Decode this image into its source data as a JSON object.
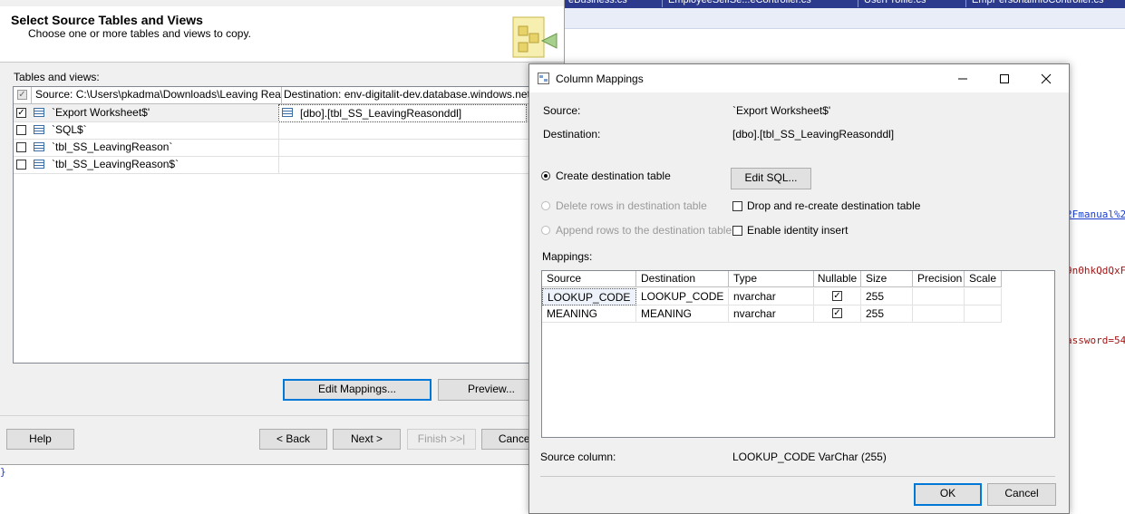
{
  "ide": {
    "tabs": [
      "eBusiness.cs",
      "EmployeeSelfSe...eController.cs",
      "UserProfile.cs",
      "EmpPersonalInfoController.cs"
    ],
    "code_fragments": [
      "2Fmanual%2",
      "9n0hkQdQxF",
      "assword=54"
    ]
  },
  "wizard": {
    "title": "Select Source Tables and Views",
    "subtitle": "Choose one or more tables and views to copy.",
    "list_label": "Tables and views:",
    "col_source": "Source: C:\\Users\\pkadma\\Downloads\\Leaving Rea...",
    "col_destination": "Destination: env-digitalit-dev.database.windows.net",
    "rows": [
      {
        "source": "`Export Worksheet$'",
        "destination": "[dbo].[tbl_SS_LeavingReasonddl]",
        "checked": true
      },
      {
        "source": "`SQL$`",
        "destination": "",
        "checked": false
      },
      {
        "source": "`tbl_SS_LeavingReason`",
        "destination": "",
        "checked": false
      },
      {
        "source": "`tbl_SS_LeavingReason$`",
        "destination": "",
        "checked": false
      }
    ],
    "edit_mappings": "Edit Mappings...",
    "preview": "Preview...",
    "help": "Help",
    "back": "< Back",
    "next": "Next >",
    "finish": "Finish >>|",
    "cancel": "Cancel"
  },
  "dialog": {
    "title": "Column Mappings",
    "source_label": "Source:",
    "source_value": "`Export Worksheet$'",
    "destination_label": "Destination:",
    "destination_value": "[dbo].[tbl_SS_LeavingReasonddl]",
    "create_table": "Create destination table",
    "edit_sql": "Edit SQL...",
    "delete_rows": "Delete rows in destination table",
    "drop_recreate": "Drop and re-create destination table",
    "append_rows": "Append rows to the destination table",
    "enable_identity": "Enable identity insert",
    "mappings_label": "Mappings:",
    "columns": [
      "Source",
      "Destination",
      "Type",
      "Nullable",
      "Size",
      "Precision",
      "Scale"
    ],
    "rows": [
      {
        "source": "LOOKUP_CODE",
        "destination": "LOOKUP_CODE",
        "type": "nvarchar",
        "nullable": true,
        "size": "255",
        "precision": "",
        "scale": ""
      },
      {
        "source": "MEANING",
        "destination": "MEANING",
        "type": "nvarchar",
        "nullable": true,
        "size": "255",
        "precision": "",
        "scale": ""
      }
    ],
    "source_column_label": "Source column:",
    "source_column_value": "LOOKUP_CODE VarChar (255)",
    "ok": "OK",
    "cancel": "Cancel"
  }
}
